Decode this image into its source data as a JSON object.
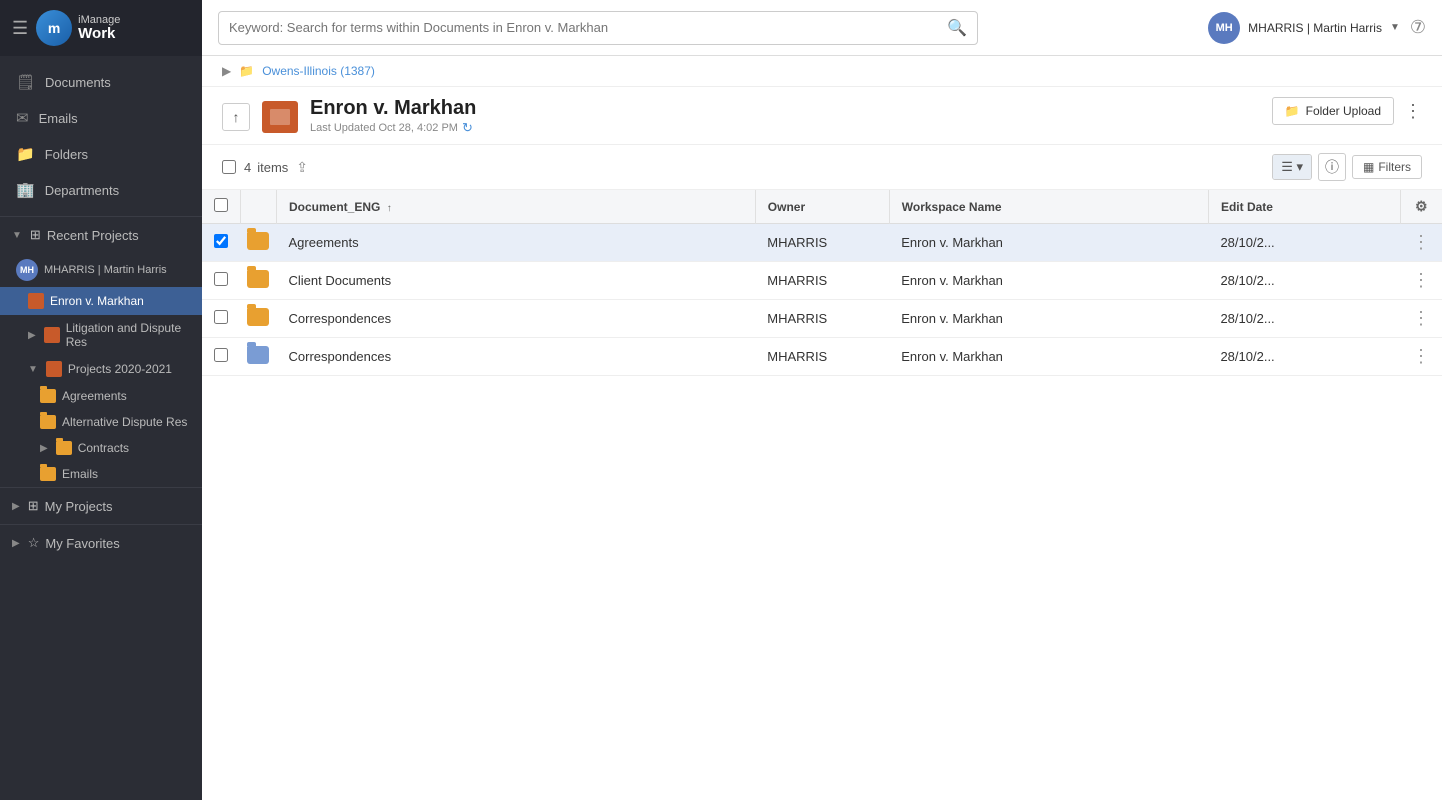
{
  "app": {
    "logo_initial": "m",
    "logo_brand": "iManage",
    "logo_product": "Work"
  },
  "topbar": {
    "search_placeholder": "Keyword: Search for terms within Documents in Enron v. Markhan",
    "user_initials": "MH",
    "user_display": "MHARRIS | Martin Harris",
    "user_name": "Martin Harris",
    "user_id": "MHARRIS"
  },
  "breadcrumb": {
    "parent": "Owens-Illinois (1387)"
  },
  "workspace": {
    "title": "Enron v. Markhan",
    "updated_label": "Last Updated Oct 28, 4:02 PM",
    "folder_upload_label": "Folder Upload"
  },
  "toolbar": {
    "items_count": "4",
    "items_label": "items",
    "filters_label": "Filters"
  },
  "table": {
    "columns": [
      {
        "key": "document",
        "label": "Document_ENG",
        "sortable": true
      },
      {
        "key": "owner",
        "label": "Owner"
      },
      {
        "key": "workspace",
        "label": "Workspace Name"
      },
      {
        "key": "edit_date",
        "label": "Edit Date"
      }
    ],
    "rows": [
      {
        "id": 1,
        "name": "Agreements",
        "type": "folder",
        "owner": "MHARRIS",
        "workspace": "Enron v. Markhan",
        "edit_date": "28/10/2...",
        "selected": true
      },
      {
        "id": 2,
        "name": "Client Documents",
        "type": "folder",
        "owner": "MHARRIS",
        "workspace": "Enron v. Markhan",
        "edit_date": "28/10/2...",
        "selected": false
      },
      {
        "id": 3,
        "name": "Correspondences",
        "type": "folder",
        "owner": "MHARRIS",
        "workspace": "Enron v. Markhan",
        "edit_date": "28/10/2...",
        "selected": false
      },
      {
        "id": 4,
        "name": "Correspondences",
        "type": "folder_locked",
        "owner": "MHARRIS",
        "workspace": "Enron v. Markhan",
        "edit_date": "28/10/2...",
        "selected": false
      }
    ]
  },
  "sidebar": {
    "nav_items": [
      {
        "id": "documents",
        "label": "Documents",
        "icon": "doc"
      },
      {
        "id": "emails",
        "label": "Emails",
        "icon": "email"
      },
      {
        "id": "folders",
        "label": "Folders",
        "icon": "folder"
      },
      {
        "id": "departments",
        "label": "Departments",
        "icon": "dept"
      }
    ],
    "recent_projects_label": "Recent Projects",
    "user_label": "MHARRIS | Martin Harris",
    "user_initials": "MH",
    "tree": {
      "active_project": "Enron v. Markhan",
      "litigation_label": "Litigation and Dispute Res",
      "projects_label": "Projects 2020-2021",
      "sub_items": [
        {
          "label": "Agreements"
        },
        {
          "label": "Alternative Dispute Res"
        },
        {
          "label": "Contracts"
        },
        {
          "label": "Emails"
        }
      ]
    },
    "my_projects_label": "My Projects",
    "my_favorites_label": "My Favorites"
  }
}
